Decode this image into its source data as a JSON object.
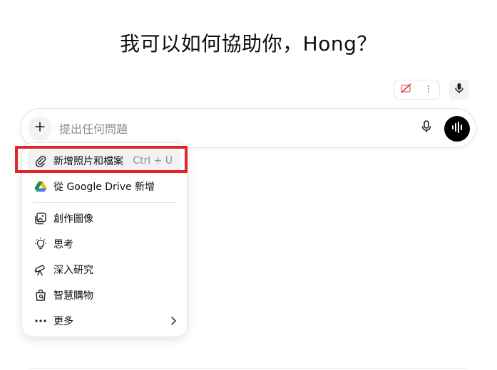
{
  "greeting": "我可以如何協助你，Hong？",
  "composer": {
    "placeholder": "提出任何問題"
  },
  "menu": {
    "items": [
      {
        "label": "新增照片和檔案",
        "shortcut": "Ctrl + U",
        "icon": "paperclip-icon"
      },
      {
        "label": "從 Google Drive 新增",
        "icon": "google-drive-icon"
      },
      {
        "label": "創作圖像",
        "icon": "image-create-icon"
      },
      {
        "label": "思考",
        "icon": "lightbulb-icon"
      },
      {
        "label": "深入研究",
        "icon": "telescope-icon"
      },
      {
        "label": "智慧購物",
        "icon": "shopping-bag-icon"
      },
      {
        "label": "更多",
        "icon": "more-dots-icon"
      }
    ]
  },
  "colors": {
    "highlight_border": "#e0262b",
    "voice_button": "#000000"
  }
}
